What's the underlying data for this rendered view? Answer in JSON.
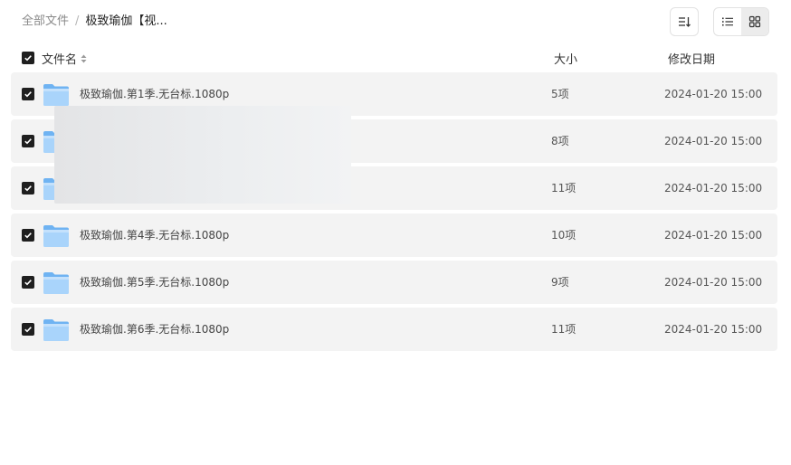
{
  "breadcrumb": {
    "root": "全部文件",
    "separator": "/",
    "current": "极致瑜伽【视..."
  },
  "toolbar": {
    "sort_icon": "sort-descending-icon",
    "list_view_icon": "list-view-icon",
    "grid_view_icon": "grid-view-icon",
    "active_view": "grid"
  },
  "columns": {
    "name": "文件名",
    "size": "大小",
    "date": "修改日期"
  },
  "files": [
    {
      "name": "极致瑜伽.第1季.无台标.1080p",
      "size": "5项",
      "date": "2024-01-20 15:00",
      "checked": true
    },
    {
      "name": "",
      "size": "8项",
      "date": "2024-01-20 15:00",
      "checked": true
    },
    {
      "name": "",
      "size": "11项",
      "date": "2024-01-20 15:00",
      "checked": true
    },
    {
      "name": "极致瑜伽.第4季.无台标.1080p",
      "size": "10项",
      "date": "2024-01-20 15:00",
      "checked": true
    },
    {
      "name": "极致瑜伽.第5季.无台标.1080p",
      "size": "9项",
      "date": "2024-01-20 15:00",
      "checked": true
    },
    {
      "name": "极致瑜伽.第6季.无台标.1080p",
      "size": "11项",
      "date": "2024-01-20 15:00",
      "checked": true
    }
  ],
  "colors": {
    "row_bg": "#f3f3f3",
    "checkbox": "#1f1f1f",
    "folder_light": "#a9d4fb",
    "folder_dark": "#6fb3f2"
  }
}
